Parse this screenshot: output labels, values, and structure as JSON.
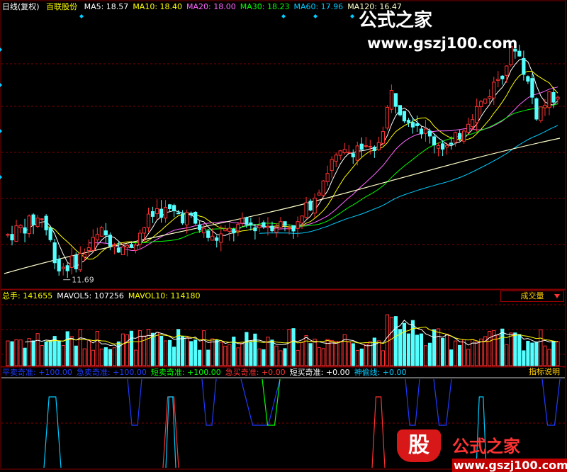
{
  "header": {
    "mode": "日线(复权)",
    "stock": "百联股份",
    "ma": [
      {
        "label": "MA5: 18.57",
        "color": "#ffffff"
      },
      {
        "label": "MA10: 18.40",
        "color": "#ffff00"
      },
      {
        "label": "MA20: 18.00",
        "color": "#ff66ff"
      },
      {
        "label": "MA30: 18.23",
        "color": "#00ff00"
      },
      {
        "label": "MA60: 17.96",
        "color": "#00ccff"
      },
      {
        "label": "MA120: 16.47",
        "color": "#ffffcc"
      }
    ]
  },
  "watermark": {
    "site": "公式之家",
    "domain": "www.gszj100.com",
    "logo_char": "股"
  },
  "volume_panel": {
    "items": [
      {
        "label": "总手: 141655",
        "color": "#ffff00"
      },
      {
        "label": "MAVOL5: 107256",
        "color": "#ffffff"
      },
      {
        "label": "MAVOL10: 114180",
        "color": "#ffff00"
      }
    ],
    "button": "成交量"
  },
  "indicator_panel": {
    "items": [
      {
        "label": "平卖奇准: +100.00",
        "color": "#1e3cff"
      },
      {
        "label": "急卖奇准: +100.00",
        "color": "#1e3cff"
      },
      {
        "label": "短卖奇准: +100.00",
        "color": "#00ff00"
      },
      {
        "label": "急买奇准: +0.00",
        "color": "#ff3333"
      },
      {
        "label": "短买奇准: +0.00",
        "color": "#ffffff"
      },
      {
        "label": "神偷线: +0.00",
        "color": "#00ccff"
      }
    ],
    "button": "指标说明"
  },
  "colors": {
    "up": "#ff3232",
    "down": "#54ffff",
    "grid": "#800000"
  },
  "chart_data": {
    "type": "candlestick",
    "low_annotation": "11.69",
    "price_range": [
      11.5,
      22.5
    ],
    "volume_range": [
      0,
      260000
    ],
    "indicator_range": [
      0,
      100
    ],
    "candles": [],
    "volumes": []
  }
}
